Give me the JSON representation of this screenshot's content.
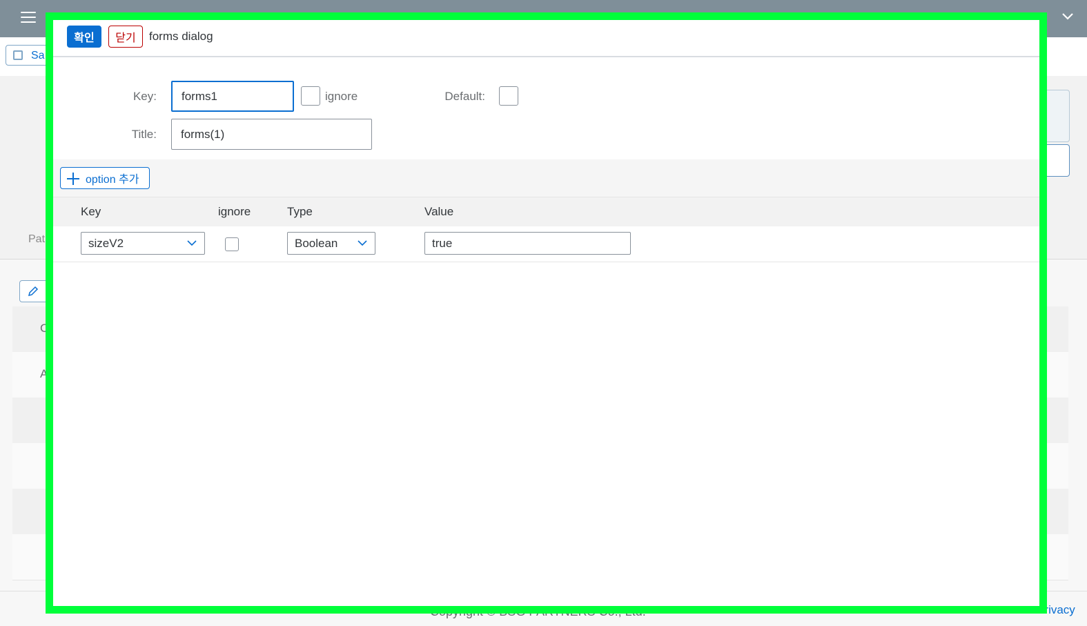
{
  "background": {
    "save_label": "Sa",
    "side_label": "Pat",
    "row_letters": [
      "C",
      "A"
    ],
    "footer_copyright": "Copyright © BSG PARTNERS Co., Ltd.",
    "footer_links": "Home Privacy"
  },
  "dialog": {
    "confirm_label": "확인",
    "close_label": "닫기",
    "title": "forms dialog",
    "key_label": "Key:",
    "key_value": "forms1",
    "ignore_label": "ignore",
    "default_label": "Default:",
    "title_label": "Title:",
    "title_value": "forms(1)",
    "add_option_label": "option 추가",
    "columns": {
      "key": "Key",
      "ignore": "ignore",
      "type": "Type",
      "value": "Value"
    },
    "rows": [
      {
        "key": "sizeV2",
        "ignore": false,
        "type": "Boolean",
        "value": "true"
      }
    ]
  },
  "colors": {
    "accent": "#0a6ed1",
    "danger": "#bb0000",
    "highlight_frame": "#00ff3a"
  }
}
